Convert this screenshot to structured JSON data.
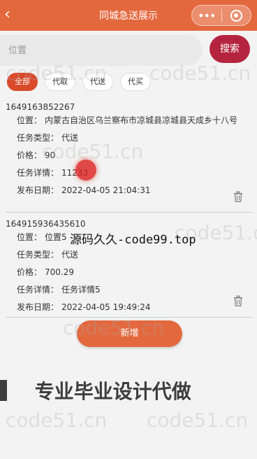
{
  "nav": {
    "back": "‹",
    "title": "同城急送展示",
    "more": "•••",
    "target_icon": "target-icon"
  },
  "search": {
    "placeholder": "位置",
    "button": "搜索"
  },
  "tabs": [
    {
      "label": "全部",
      "active": true
    },
    {
      "label": "代取",
      "active": false
    },
    {
      "label": "代送",
      "active": false
    },
    {
      "label": "代买",
      "active": false
    }
  ],
  "orders": [
    {
      "order_no": "1649163852267",
      "location_label": "位置：",
      "location": "内蒙古自治区乌兰察布市凉城县凉城县天成乡十八号",
      "type_label": "任务类型：",
      "type": "代送",
      "price_label": "价格：",
      "price": "90",
      "detail_label": "任务详情：",
      "detail": "11233",
      "date_label": "发布日期：",
      "date": "2022-04-05 21:04:31"
    },
    {
      "order_no": "164915936435610",
      "location_label": "位置：",
      "location": "位置5",
      "type_label": "任务类型：",
      "type": "代送",
      "price_label": "价格：",
      "price": "700.29",
      "detail_label": "任务详情：",
      "detail": "任务详情5",
      "date_label": "发布日期：",
      "date": "2022-04-05 19:49:24"
    }
  ],
  "add_button": "新增",
  "watermark": "code51.cn",
  "overlay_text": "源码久久-code99.top",
  "banner": "专业毕业设计代做",
  "colors": {
    "nav": "#e4683e",
    "search_button": "#b5243f",
    "tab_active": "#d94a2a",
    "add_button": "#e4683e"
  }
}
